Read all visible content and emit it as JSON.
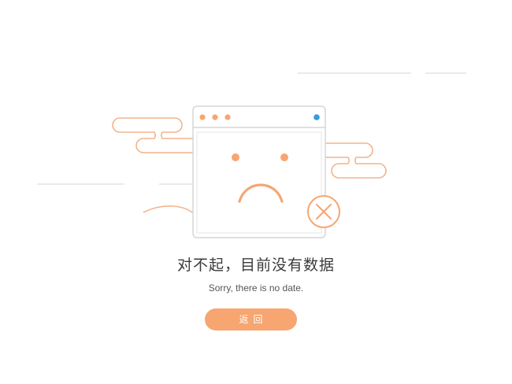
{
  "empty_state": {
    "title": "对不起，目前没有数据",
    "subtitle": "Sorry, there is no date.",
    "back_button_label": "返回"
  },
  "colors": {
    "accent_orange": "#f7a571",
    "line_orange": "#f3b48a",
    "gray_line": "#d9d9d9",
    "blue_dot": "#3a9be0",
    "button_text": "#ffffff"
  },
  "icons": {
    "browser_window": "browser-window-icon",
    "sad_face": "sad-face-icon",
    "close_circle": "close-circle-icon"
  }
}
